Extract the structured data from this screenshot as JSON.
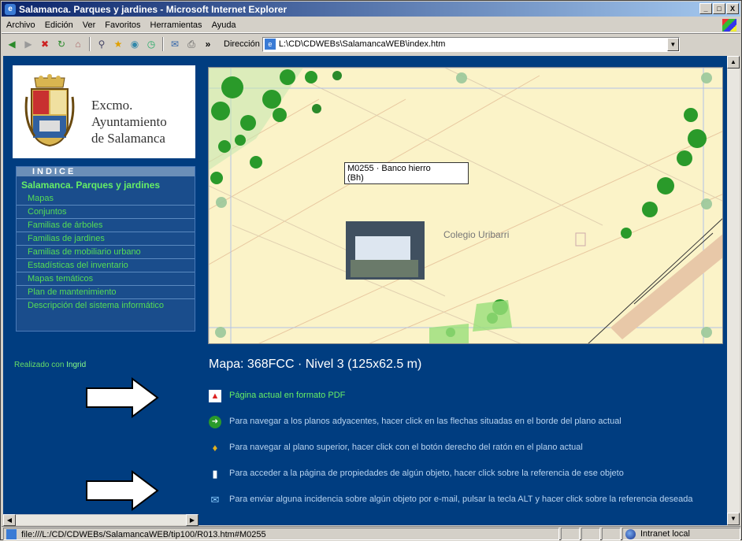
{
  "window": {
    "title": "Salamanca. Parques y jardines - Microsoft Internet Explorer",
    "min": "_",
    "max": "□",
    "close": "X"
  },
  "menu": [
    "Archivo",
    "Edición",
    "Ver",
    "Favoritos",
    "Herramientas",
    "Ayuda"
  ],
  "address": {
    "label": "Dirección",
    "url": "L:\\CD\\CDWEBs\\SalamancaWEB\\index.htm"
  },
  "logo": {
    "line1": "Excmo.",
    "line2": "Ayuntamiento",
    "line3": "de Salamanca"
  },
  "indice": {
    "heading": "INDICE",
    "section": "Salamanca. Parques y jardines",
    "items": [
      "Mapas",
      "Conjuntos",
      "Familias de árboles",
      "Familias de jardines",
      "Familias de mobiliario urbano",
      "Estadísticas del inventario",
      "Mapas temáticos",
      "Plan de mantenimiento",
      "Descripción del sistema informático"
    ]
  },
  "realizado": {
    "prefix": "Realizado con",
    "link": "Ingrid"
  },
  "map": {
    "tooltip_line1": "M0255 · Banco hierro",
    "tooltip_line2": "(Bh)",
    "place_label": "Colegio Uribarri",
    "title": "Mapa: 368FCC · Nivel 3 (125x62.5 m)"
  },
  "instructions": [
    "Página actual en formato PDF",
    "Para navegar a los planos adyacentes, hacer click en las flechas situadas en el borde del plano actual",
    "Para navegar al plano superior, hacer click con el botón derecho del ratón en el plano actual",
    "Para acceder a la página de propiedades de algún objeto, hacer click sobre la referencia de ese objeto",
    "Para enviar alguna incidencia sobre algún objeto por e-mail, pulsar la tecla ALT y hacer click sobre la referencia deseada"
  ],
  "status": {
    "url": "file:///L:/CD/CDWEBs/SalamancaWEB/tip100/R013.htm#M0255",
    "zone": "Intranet local"
  },
  "colors": {
    "page_bg": "#003d80",
    "menu_link": "#55dd55",
    "map_bg": "#fbf3c8"
  }
}
